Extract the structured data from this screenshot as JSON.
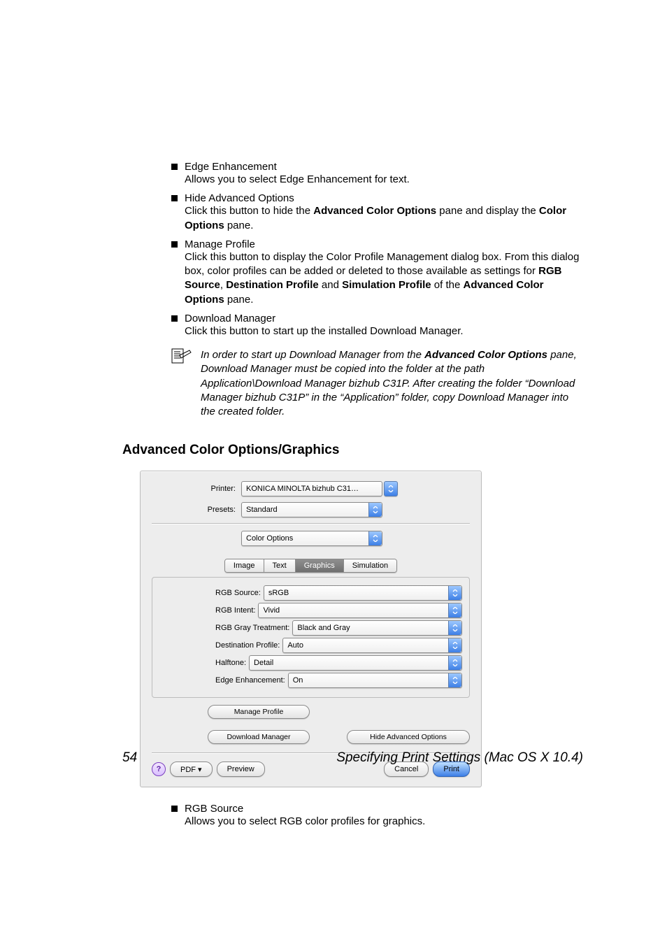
{
  "bullets": [
    {
      "title": "Edge Enhancement",
      "body": "Allows you to select Edge Enhancement for text."
    },
    {
      "title": "Hide Advanced Options",
      "body_pre": "Click this button to hide the ",
      "body_b1": "Advanced Color Options",
      "body_mid": " pane and display the ",
      "body_b2": "Color Options",
      "body_post": " pane."
    },
    {
      "title": "Manage Profile",
      "body_pre": "Click this button to display the Color Profile Management dialog box. From this dialog box, color profiles can be added or deleted to those available as settings for ",
      "b1": "RGB Source",
      "sep1": ", ",
      "b2": "Destination Profile",
      "sep2": " and ",
      "b3": "Simulation Profile",
      "mid": " of the ",
      "b4": "Advanced Color Options",
      "post": " pane."
    },
    {
      "title": "Download Manager",
      "body": "Click this button to start up the installed Download Manager."
    }
  ],
  "note": {
    "pre": "In order to start up Download Manager from the ",
    "b1": "Advanced Color Options",
    "post": " pane, Download Manager must be copied into the folder at the path Application\\Download Manager bizhub C31P. After creating the folder “Download Manager bizhub C31P” in the “Application” folder, copy Download Manager into the created folder."
  },
  "section_heading": "Advanced Color Options/Graphics",
  "dialog": {
    "printer_label": "Printer:",
    "printer_value": "KONICA MINOLTA bizhub C31…",
    "presets_label": "Presets:",
    "presets_value": "Standard",
    "pane_value": "Color Options",
    "tabs": [
      "Image",
      "Text",
      "Graphics",
      "Simulation"
    ],
    "active_tab": 2,
    "options": [
      {
        "label": "RGB Source:",
        "value": "sRGB"
      },
      {
        "label": "RGB Intent:",
        "value": "Vivid"
      },
      {
        "label": "RGB Gray Treatment:",
        "value": "Black and Gray"
      },
      {
        "label": "Destination Profile:",
        "value": "Auto"
      },
      {
        "label": "Halftone:",
        "value": "Detail"
      },
      {
        "label": "Edge Enhancement:",
        "value": "On"
      }
    ],
    "manage_profile": "Manage Profile",
    "download_manager": "Download Manager",
    "hide_advanced": "Hide Advanced Options",
    "help": "?",
    "pdf": "PDF ▾",
    "preview": "Preview",
    "cancel": "Cancel",
    "print": "Print"
  },
  "bullet_after": {
    "title": "RGB Source",
    "body": "Allows you to select RGB color profiles for graphics."
  },
  "footer": {
    "num": "54",
    "text": "Specifying Print Settings (Mac OS X 10.4)"
  }
}
